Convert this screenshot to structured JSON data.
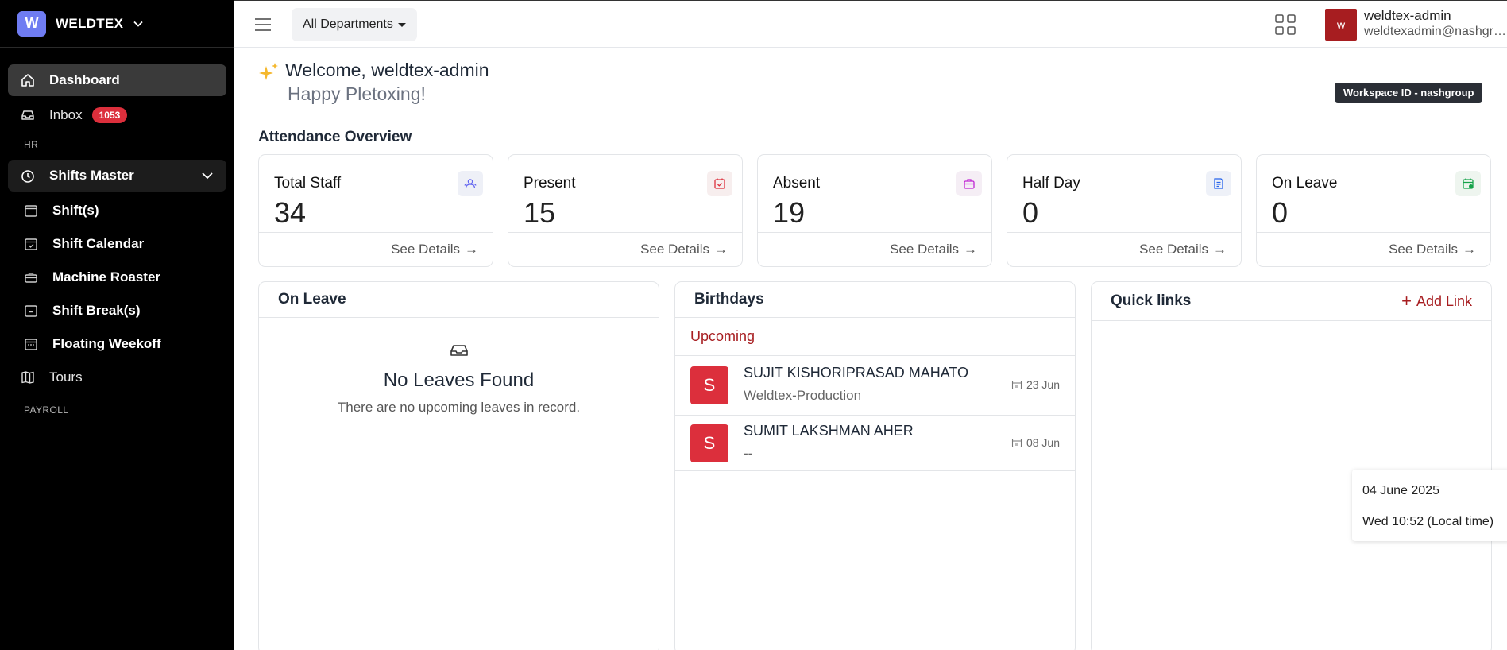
{
  "brand": {
    "logo_letter": "W",
    "name": "WELDTEX"
  },
  "sidebar": {
    "items": [
      {
        "label": "Dashboard",
        "icon": "home-icon"
      },
      {
        "label": "Inbox",
        "icon": "inbox-icon",
        "badge": "1053"
      }
    ],
    "section_hr": "HR",
    "group": {
      "label": "Shifts Master",
      "icon": "clock-icon"
    },
    "sub_items": [
      {
        "label": "Shift(s)",
        "icon": "calendar-icon"
      },
      {
        "label": "Shift Calendar",
        "icon": "calendar-check-icon"
      },
      {
        "label": "Machine Roaster",
        "icon": "briefcase-icon"
      },
      {
        "label": "Shift Break(s)",
        "icon": "calendar-minus-icon"
      },
      {
        "label": "Floating Weekoff",
        "icon": "calendar-grid-icon"
      }
    ],
    "tours": {
      "label": "Tours",
      "icon": "map-icon"
    },
    "section_payroll": "PAYROLL"
  },
  "topbar": {
    "department": "All Departments",
    "user": {
      "avatar_letter": "w",
      "name": "weldtex-admin",
      "email": "weldtexadmin@nashgroup"
    }
  },
  "welcome": {
    "title": "Welcome, weldtex-admin",
    "subtitle": "Happy Pletoxing!",
    "workspace_badge": "Workspace ID - nashgroup"
  },
  "attendance": {
    "title": "Attendance Overview",
    "see_details": "See Details",
    "cards": [
      {
        "label": "Total Staff",
        "value": "34",
        "icon": "users-icon",
        "color": "#6366f1",
        "bg": "#eef0f7"
      },
      {
        "label": "Present",
        "value": "15",
        "icon": "calendar-check-icon",
        "color": "#dc2f3c",
        "bg": "#f7eeee"
      },
      {
        "label": "Absent",
        "value": "19",
        "icon": "briefcase-icon",
        "color": "#c026d3",
        "bg": "#f5eef5"
      },
      {
        "label": "Half Day",
        "value": "0",
        "icon": "document-icon",
        "color": "#2563eb",
        "bg": "#eef1f8"
      },
      {
        "label": "On Leave",
        "value": "0",
        "icon": "calendar-plus-icon",
        "color": "#16a34a",
        "bg": "#eef5ef"
      }
    ]
  },
  "on_leave": {
    "title": "On Leave",
    "empty_title": "No Leaves Found",
    "empty_desc": "There are no upcoming leaves in record."
  },
  "birthdays": {
    "title": "Birthdays",
    "upcoming_label": "Upcoming",
    "people": [
      {
        "initial": "S",
        "name": "SUJIT KISHORIPRASAD MAHATO",
        "dept": "Weldtex-Production",
        "date": "23 Jun"
      },
      {
        "initial": "S",
        "name": "SUMIT LAKSHMAN AHER",
        "dept": "--",
        "date": "08 Jun"
      }
    ]
  },
  "quick_links": {
    "title": "Quick links",
    "add_label": "Add Link"
  },
  "datetime": {
    "date": "04 June 2025",
    "time": "Wed 10:52 (Local time)"
  }
}
